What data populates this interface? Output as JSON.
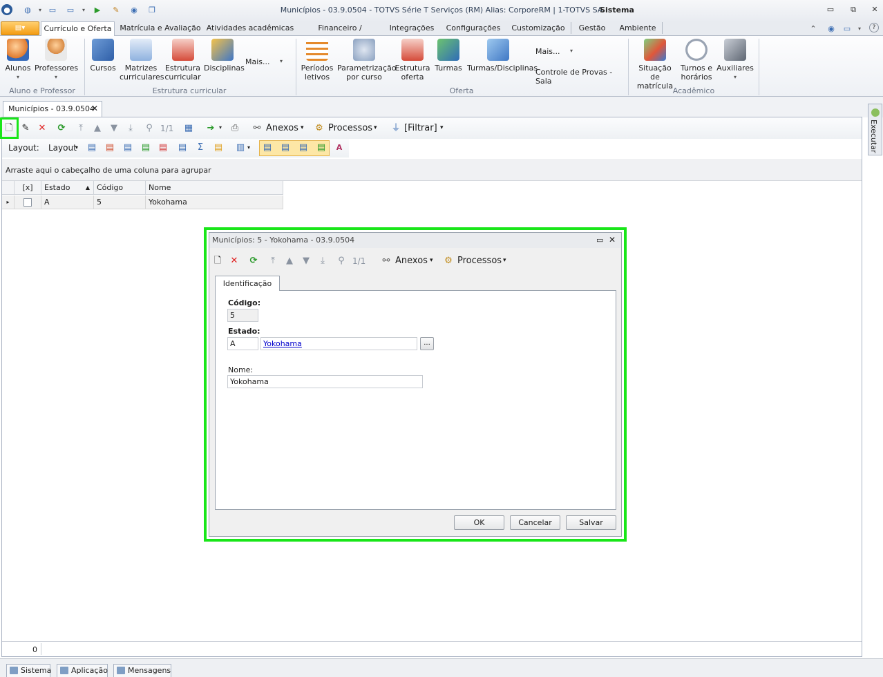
{
  "window": {
    "title": "Municípios - 03.9.0504 - TOTVS Série T Serviços (RM) Alias: CorporeRM | 1-TOTVS SA",
    "title_right": "Sistema",
    "controls": {
      "minimize": "▭",
      "restore": "⧉",
      "close": "✕"
    }
  },
  "ribbon": {
    "file_menu": "▤▾",
    "tabs": [
      "Currículo e Oferta",
      "Matrícula e Avaliação",
      "Atividades acadêmicas",
      "Financeiro / Contábil",
      "Integrações",
      "Configurações",
      "Customização",
      "Gestão",
      "Ambiente"
    ],
    "groups": [
      {
        "label": "Aluno e Professor",
        "buttons": [
          "Alunos",
          "Professores"
        ]
      },
      {
        "label": "Estrutura curricular",
        "buttons": [
          "Cursos",
          "Matrizes\ncurriculares",
          "Estrutura\ncurricular",
          "Disciplinas",
          "Mais..."
        ]
      },
      {
        "label": "Oferta",
        "buttons": [
          "Períodos\nletivos",
          "Parametrização\npor curso",
          "Estrutura\noferta",
          "Turmas",
          "Turmas/Disciplinas",
          "Mais...",
          "Controle de Provas - Sala"
        ]
      },
      {
        "label": "Acadêmico",
        "buttons": [
          "Situação de\nmatrícula",
          "Turnos e\nhorários",
          "Auxiliares"
        ]
      }
    ]
  },
  "document_tab": {
    "label": "Municípios - 03.9.0504",
    "close": "✕"
  },
  "toolbar": {
    "page_counter": "1/1",
    "anexos": "Anexos",
    "processos": "Processos",
    "filtrar": "[Filtrar]",
    "layout_label": "Layout:",
    "layout_menu": "Layout"
  },
  "grid": {
    "group_hint": "Arraste aqui o cabeçalho de uma coluna para agrupar",
    "columns": [
      "[x]",
      "Estado",
      "Código",
      "Nome"
    ],
    "rows": [
      {
        "estado": "A",
        "codigo": "5",
        "nome": "Yokohama"
      }
    ],
    "record_count": "0"
  },
  "side_panel": {
    "label": "Executar"
  },
  "bottom_tabs": [
    "Sistema",
    "Aplicação",
    "Mensagens"
  ],
  "dialog": {
    "title": "Municípios: 5 - Yokohama - 03.9.0504",
    "page_counter": "1/1",
    "anexos": "Anexos",
    "processos": "Processos",
    "tab": "Identificação",
    "codigo_label": "Código:",
    "codigo_value": "5",
    "estado_label": "Estado:",
    "estado_code": "A",
    "estado_link": "Yokohama",
    "lookup_button": "...",
    "nome_label": "Nome:",
    "nome_value": "Yokohama",
    "ok": "OK",
    "cancel": "Cancelar",
    "save": "Salvar"
  },
  "colors": {
    "highlight": "#19e619",
    "accent": "#f49c14",
    "link": "#0000cc",
    "delete": "#e02020",
    "refresh": "#2a9a2a"
  }
}
